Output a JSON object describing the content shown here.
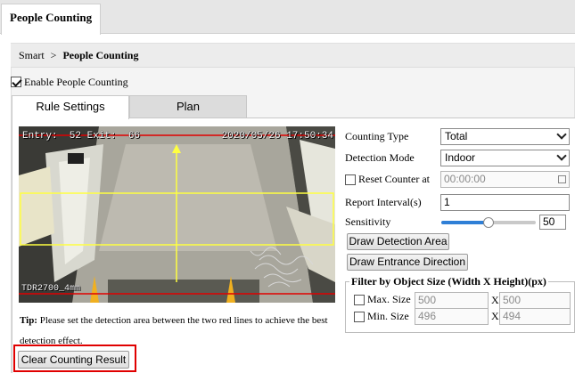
{
  "top_tab": {
    "label": "People Counting"
  },
  "breadcrumb": {
    "parent": "Smart",
    "separator": ">",
    "current": "People Counting"
  },
  "enable": {
    "label": "Enable People Counting",
    "checked": true
  },
  "tabs": [
    {
      "label": "Rule Settings",
      "active": true
    },
    {
      "label": "Plan",
      "active": false
    }
  ],
  "video": {
    "osd_counts": "Entry:  52 Exit:  66",
    "osd_time": "2020/05/26 17:50:34",
    "osd_model": "TDR2700_4mm"
  },
  "tip": {
    "prefix": "Tip:",
    "text": "Please set the detection area between the two red lines to achieve the best detection effect."
  },
  "clear_button": "Clear Counting Result",
  "form": {
    "counting_type": {
      "label": "Counting Type",
      "value": "Total"
    },
    "detection_mode": {
      "label": "Detection Mode",
      "value": "Indoor"
    },
    "reset_counter": {
      "label": "Reset Counter at",
      "value": "00:00:00",
      "checked": false
    },
    "report_interval": {
      "label": "Report Interval(s)",
      "value": "1"
    },
    "sensitivity": {
      "label": "Sensitivity",
      "value": "50",
      "level": 0.5
    },
    "draw_detection_area": "Draw Detection Area",
    "draw_entrance_direction": "Draw Entrance Direction"
  },
  "filter": {
    "title": "Filter by Object Size (Width X Height)(px)",
    "separator": "X",
    "max": {
      "label": "Max. Size",
      "width": "500",
      "height": "500",
      "checked": false
    },
    "min": {
      "label": "Min. Size",
      "width": "496",
      "height": "494",
      "checked": false
    }
  },
  "colors": {
    "accent": "#2f7fd6",
    "highlight": "#e00000",
    "detection_line": "#ffff40",
    "red_line": "#e00000"
  }
}
